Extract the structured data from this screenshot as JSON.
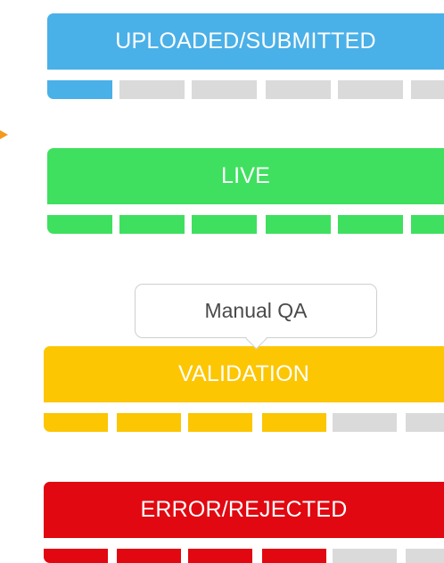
{
  "colors": {
    "uploaded": "#4ab0e8",
    "live": "#3fe05f",
    "validation": "#fcc603",
    "error": "#e10811",
    "inactive": "#dadada",
    "arrow": "#f39a1e"
  },
  "statuses": [
    {
      "key": "uploaded",
      "label": "UPLOADED/SUBMITTED",
      "progress_segments_filled": 1,
      "progress_segments_total": 6
    },
    {
      "key": "live",
      "label": "LIVE",
      "progress_segments_filled": 6,
      "progress_segments_total": 6
    },
    {
      "key": "validation",
      "label": "VALIDATION",
      "progress_segments_filled": 4,
      "progress_segments_total": 6
    },
    {
      "key": "error",
      "label": "ERROR/REJECTED",
      "progress_segments_filled": 4,
      "progress_segments_total": 6
    }
  ],
  "callout": {
    "text": "Manual QA"
  }
}
